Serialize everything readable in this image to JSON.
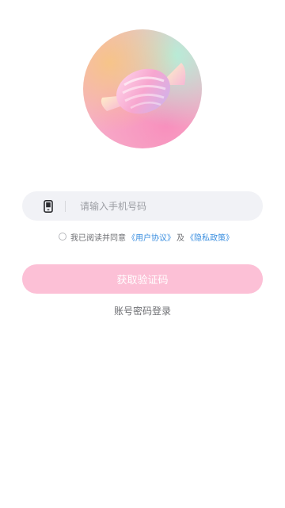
{
  "logo": {
    "icon": "candy-icon"
  },
  "phone": {
    "icon": "phone-icon",
    "placeholder": "请输入手机号码",
    "value": ""
  },
  "agreement": {
    "checked": false,
    "prefix": "我已阅读并同意",
    "user_agreement": "《用户协议》",
    "conjunction": "及",
    "privacy_policy": "《隐私政策》"
  },
  "buttons": {
    "get_code": "获取验证码",
    "password_login": "账号密码登录"
  },
  "colors": {
    "button_bg": "#fcc0d6",
    "link": "#3b8fe0",
    "input_bg": "#f1f2f6"
  }
}
